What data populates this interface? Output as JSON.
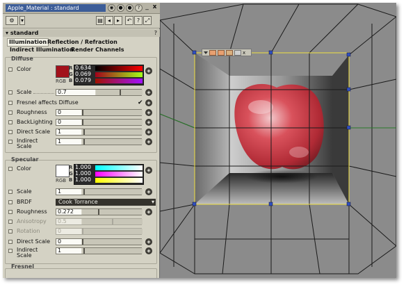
{
  "window": {
    "title": "Apple_Material : standard"
  },
  "section": {
    "title": "standard",
    "help": "?"
  },
  "tabs": [
    {
      "label": "Illumination"
    },
    {
      "label": "Reflection / Refraction"
    },
    {
      "label": "Indirect Illumination"
    },
    {
      "label": "Render Channels"
    }
  ],
  "diffuse": {
    "group_label": "Diffuse",
    "color": {
      "label": "Color",
      "hex": "#a2111a",
      "r": "0.634",
      "g": "0.069",
      "b": "0.079",
      "rgb_label": "RGB"
    },
    "scale": {
      "label": "Scale",
      "value": "0.7"
    },
    "fresnel_affects": {
      "label": "Fresnel affects Diffuse",
      "checked": true
    },
    "roughness": {
      "label": "Roughness",
      "value": "0"
    },
    "backlighting": {
      "label": "BackLighting",
      "value": "0"
    },
    "direct_scale": {
      "label": "Direct Scale",
      "value": "1"
    },
    "indirect_scale": {
      "label": "Indirect Scale",
      "value": "1"
    }
  },
  "specular": {
    "group_label": "Specular",
    "color": {
      "label": "Color",
      "hex": "#ffffff",
      "r": "1.000",
      "g": "1.000",
      "b": "1.000",
      "rgb_label": "RGB"
    },
    "scale": {
      "label": "Scale",
      "value": "1"
    },
    "brdf": {
      "label": "BRDF",
      "value": "Cook Torrance"
    },
    "roughness": {
      "label": "Roughness",
      "value": "0.272"
    },
    "anisotropy": {
      "label": "Anisotropy",
      "value": "0.5"
    },
    "rotation": {
      "label": "Rotation",
      "value": "0"
    },
    "direct_scale": {
      "label": "Direct Scale",
      "value": "0"
    },
    "indirect_scale": {
      "label": "Indirect Scale",
      "value": "1"
    }
  },
  "fresnel_group": {
    "label": "Fresnel"
  },
  "channel_labels": {
    "r": "R",
    "g": "G",
    "b": "B"
  },
  "colors": {
    "title_bar": "#3c5d98",
    "panel": "#d4d2c4",
    "viewport": "#8b8b8b",
    "apple": "#c8404a",
    "wire_highlight": "#f0e040"
  }
}
